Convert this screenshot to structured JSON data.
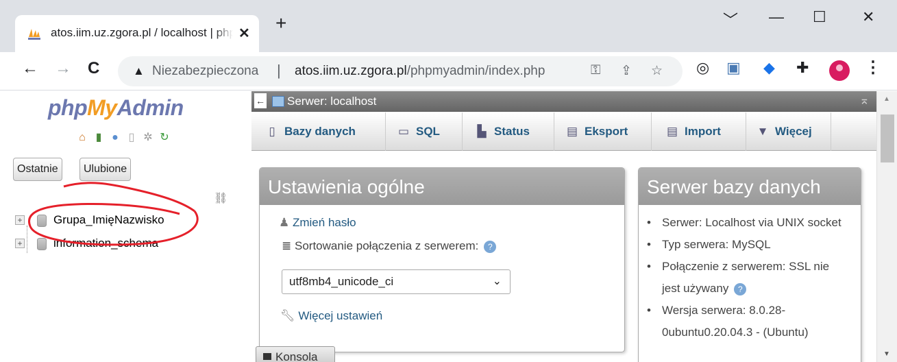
{
  "browser": {
    "tab_title": "atos.iim.uz.zgora.pl / localhost | phpMyAdmin",
    "tab_close": "✕",
    "new_tab": "+",
    "window_controls": {
      "minimize_alt": "﹀",
      "minimize": "—",
      "maximize": "☐",
      "close": "✕"
    },
    "nav": {
      "back": "←",
      "forward": "→",
      "reload": "C"
    },
    "url_security_label": "Niezabezpieczona",
    "url_separator": "|",
    "url_host": "atos.iim.uz.zgora.pl",
    "url_path": "/phpmyadmin/index.php",
    "menu": "⋮"
  },
  "pma": {
    "logo": {
      "php": "php",
      "my": "My",
      "admin": "Admin"
    },
    "nav_buttons": {
      "recent": "Ostatnie",
      "favorites": "Ulubione"
    },
    "databases": [
      {
        "name": "Grupa_ImięNazwisko"
      },
      {
        "name": "information_schema"
      }
    ],
    "server_bar": {
      "title": "Serwer: localhost"
    },
    "menu_tabs": [
      {
        "label": "Bazy danych",
        "icon": "database-icon"
      },
      {
        "label": "SQL",
        "icon": "sql-icon"
      },
      {
        "label": "Status",
        "icon": "status-icon"
      },
      {
        "label": "Eksport",
        "icon": "export-icon"
      },
      {
        "label": "Import",
        "icon": "import-icon"
      },
      {
        "label": "Więcej",
        "icon": "dropdown-triangle-icon"
      }
    ],
    "general_settings": {
      "title": "Ustawienia ogólne",
      "change_password": "Zmień hasło",
      "collation_label": "Sortowanie połączenia z serwerem:",
      "collation_value": "utf8mb4_unicode_ci",
      "more_settings": "Więcej ustawień"
    },
    "db_server": {
      "title": "Serwer bazy danych",
      "items": [
        "Serwer: Localhost via UNIX socket",
        "Typ serwera: MySQL",
        "Połączenie z serwerem: SSL nie jest używany",
        "Wersja serwera: 8.0.28-0ubuntu0.20.04.3 - (Ubuntu)"
      ]
    },
    "console": "Konsola"
  },
  "colors": {
    "link": "#235a81",
    "annotation": "#e5202a",
    "pma_orange": "#f29d24",
    "pma_blue": "#6c78af"
  }
}
